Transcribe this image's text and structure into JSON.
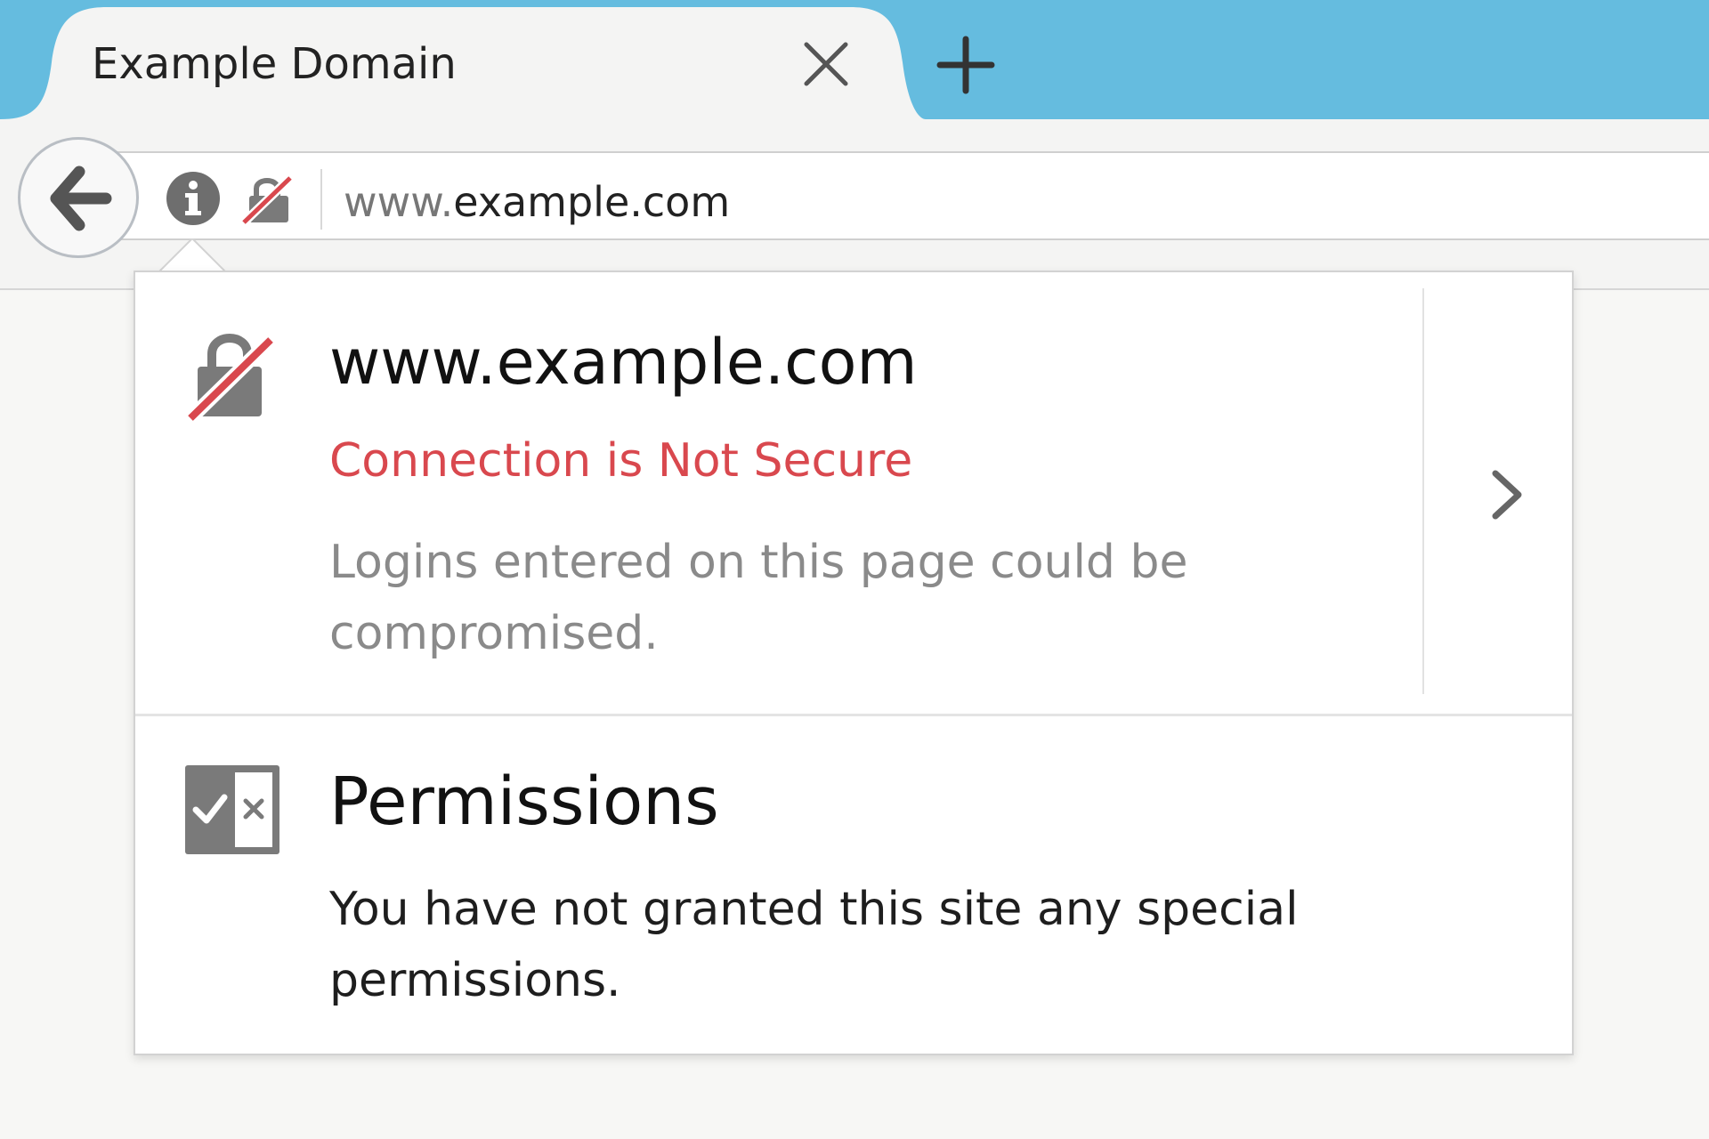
{
  "tab": {
    "title": "Example Domain",
    "close_icon": "close-icon",
    "new_tab_icon": "plus-icon"
  },
  "navbar": {
    "back_icon": "back-arrow-icon",
    "info_icon": "info-icon",
    "insecure_icon": "insecure-lock-icon",
    "url_prefix": "www.",
    "url_domain": "example.com"
  },
  "popup": {
    "host": "www.example.com",
    "status": "Connection is Not Secure",
    "description": "Logins entered on this page could be compromised.",
    "permissions_title": "Permissions",
    "permissions_desc": "You have not granted this site any special permissions."
  },
  "colors": {
    "tabstrip": "#65bcdf",
    "insecure_red": "#d9484e",
    "icon_gray": "#7a7a7a"
  }
}
